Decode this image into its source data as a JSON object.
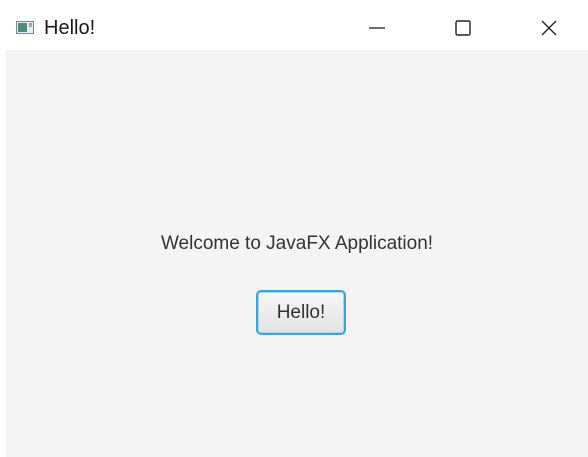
{
  "window": {
    "title": "Hello!",
    "icon": "java-app-icon",
    "controls": {
      "minimize_icon": "minimize-icon",
      "maximize_icon": "maximize-icon",
      "close_icon": "close-icon"
    }
  },
  "main": {
    "welcome_text": "Welcome to JavaFX Application!",
    "hello_button_label": "Hello!"
  },
  "colors": {
    "background": "#f4f4f4",
    "titlebar": "#ffffff",
    "button_focus_border": "#3aa3d8"
  }
}
